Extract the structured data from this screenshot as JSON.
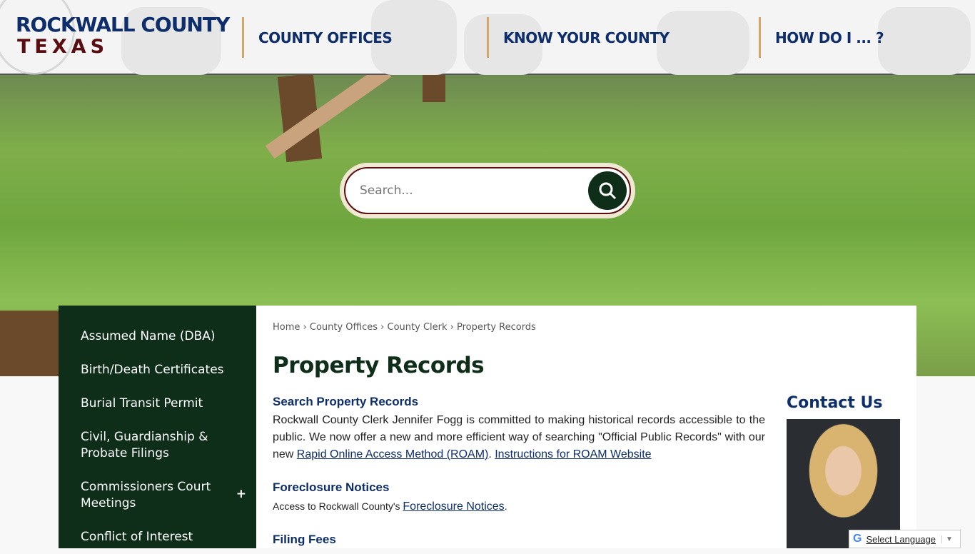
{
  "header": {
    "logo_line1": "ROCKWALL COUNTY",
    "logo_line2": "TEXAS",
    "nav": [
      "COUNTY OFFICES",
      "KNOW YOUR COUNTY",
      "HOW DO I ... ?"
    ]
  },
  "search": {
    "placeholder": "Search..."
  },
  "sidebar": {
    "items": [
      {
        "label": "Assumed Name (DBA)"
      },
      {
        "label": "Birth/Death Certificates"
      },
      {
        "label": "Burial Transit Permit"
      },
      {
        "label": "Civil, Guardianship & Probate Filings"
      },
      {
        "label": "Commissioners Court Meetings",
        "expand": "+"
      },
      {
        "label": "Conflict of Interest"
      }
    ]
  },
  "breadcrumb": [
    "Home",
    "County Offices",
    "County Clerk",
    "Property Records"
  ],
  "breadcrumb_sep": "›",
  "page_title": "Property Records",
  "sections": {
    "s1": {
      "heading": "Search Property Records",
      "text1": "Rockwall County Clerk Jennifer Fogg is committed to making historical records accessible to the public. We now offer a new and more efficient way of searching \"Official Public Records\" with our new ",
      "link1": "Rapid Online Access Method (ROAM)",
      "mid": ". ",
      "link2": "Instructions for ROAM Website"
    },
    "s2": {
      "heading": "Foreclosure Notices",
      "text": "Access to Rockwall County's ",
      "link": "Foreclosure Notices",
      "end": "."
    },
    "s3": {
      "heading": "Filing Fees"
    }
  },
  "contact": {
    "title": "Contact Us"
  },
  "translate": {
    "label": "Select Language",
    "arrow": "▼"
  }
}
